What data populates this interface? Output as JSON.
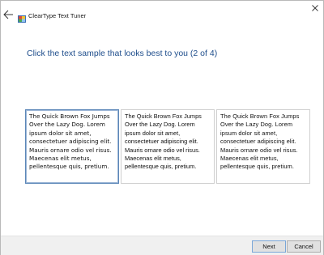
{
  "window": {
    "title": "ClearType Text Tuner"
  },
  "icons": {
    "back": "back-arrow-icon",
    "app": "cleartype-app-icon",
    "close": "close-icon"
  },
  "heading": "Click the text sample that looks best to you (2 of 4)",
  "samples": [
    {
      "text": "The Quick Brown Fox Jumps\nOver the Lazy Dog. Lorem\nipsum dolor sit amet,\nconsectetuer adipiscing elit.\nMauris ornare odio vel risus.\nMaecenas elit metus,\npellentesque quis, pretium.",
      "selected": true
    },
    {
      "text": "The Quick Brown Fox Jumps\nOver the Lazy Dog. Lorem\nipsum dolor sit amet,\nconsectetuer adipiscing elit.\nMauris ornare odio vel risus.\nMaecenas elit metus,\npellentesque quis, pretium.",
      "selected": false
    },
    {
      "text": "The Quick Brown Fox Jumps\nOver the Lazy Dog. Lorem\nipsum dolor sit amet,\nconsectetuer adipiscing elit.\nMauris ornare odio vel risus.\nMaecenas elit metus,\npellentesque quis, pretium.",
      "selected": false
    }
  ],
  "footer": {
    "next_label": "Next",
    "cancel_label": "Cancel"
  },
  "colors": {
    "heading": "#1f4e8c",
    "selected_border": "#5b86b8",
    "footer_bg": "#f0f0f0"
  }
}
